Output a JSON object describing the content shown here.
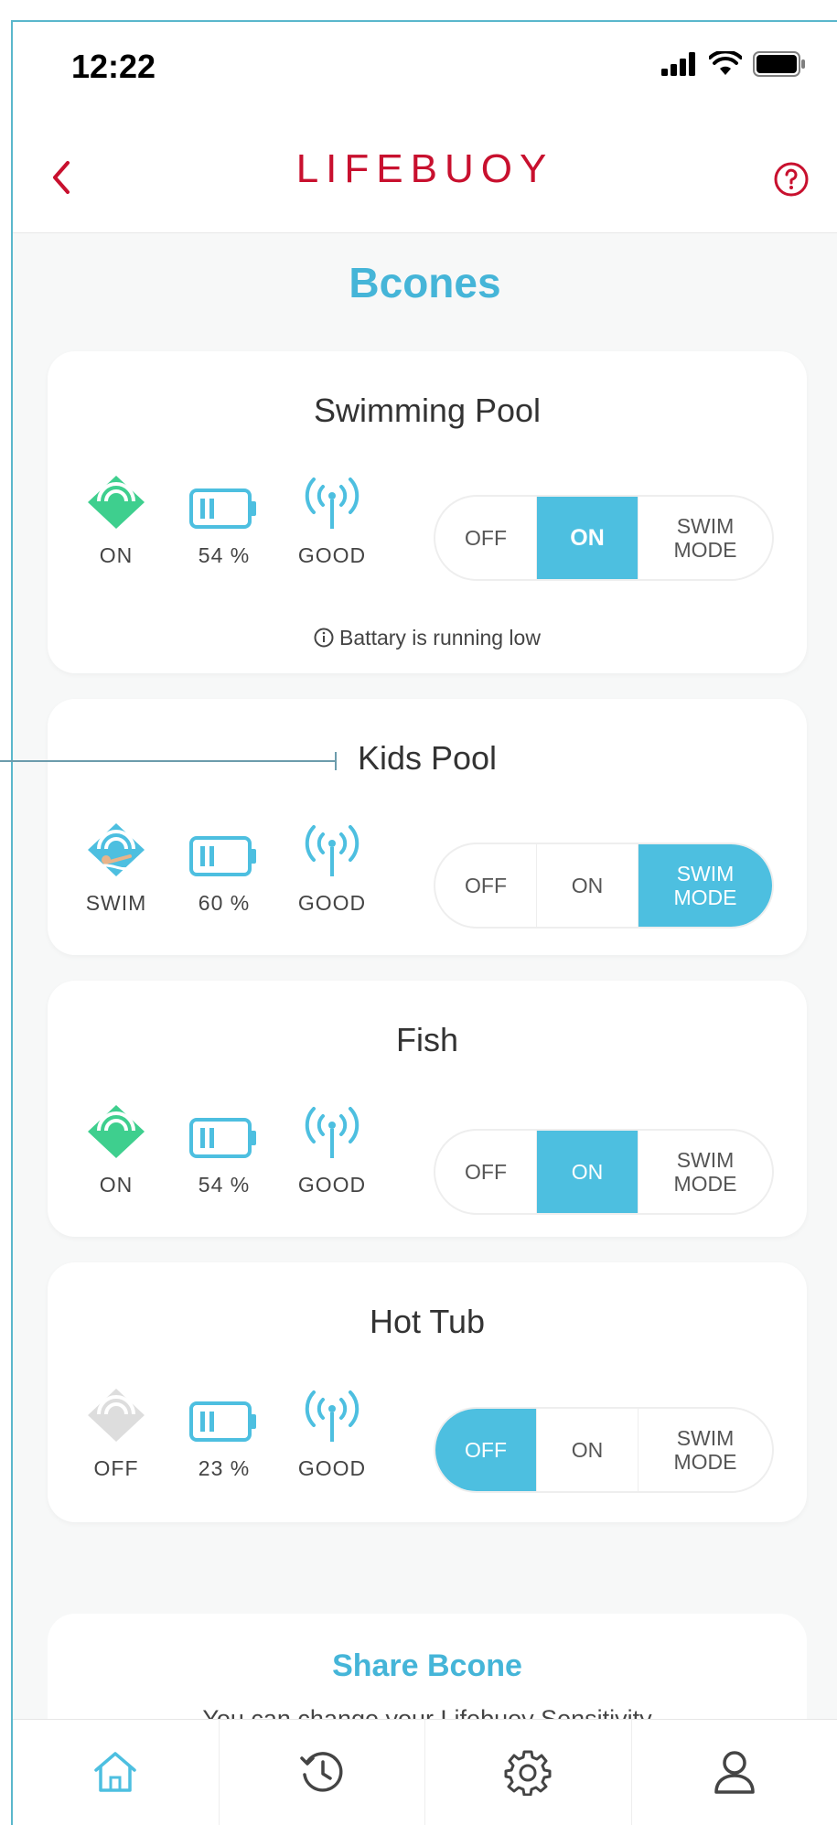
{
  "status_bar": {
    "time": "12:22",
    "icons": [
      "signal-icon",
      "wifi-icon",
      "battery-icon"
    ]
  },
  "header": {
    "logo": "LIFEBUOY",
    "back_icon": "chevron-left-icon",
    "help_icon": "help-circle-icon"
  },
  "page": {
    "title": "Bcones"
  },
  "colors": {
    "accent": "#4dbfe0",
    "brand": "#c8102e",
    "on_green": "#3ecf8e",
    "off_grey": "#dddddd"
  },
  "bcones": [
    {
      "name": "Swimming Pool",
      "status": "ON",
      "battery": "54 %",
      "signal": "GOOD",
      "mode_options": [
        "OFF",
        "ON",
        "SWIM MODE"
      ],
      "selected_mode": "ON",
      "note": "Battary is running low"
    },
    {
      "name": "Kids Pool",
      "status": "SWIM",
      "battery": "60 %",
      "signal": "GOOD",
      "mode_options": [
        "OFF",
        "ON",
        "SWIM MODE"
      ],
      "selected_mode": "SWIM MODE"
    },
    {
      "name": "Fish",
      "status": "ON",
      "battery": "54 %",
      "signal": "GOOD",
      "mode_options": [
        "OFF",
        "ON",
        "SWIM MODE"
      ],
      "selected_mode": "ON"
    },
    {
      "name": "Hot Tub",
      "status": "OFF",
      "battery": "23 %",
      "signal": "GOOD",
      "mode_options": [
        "OFF",
        "ON",
        "SWIM MODE"
      ],
      "selected_mode": "OFF"
    }
  ],
  "share": {
    "title": "Share Bcone",
    "text": "You can change your Lifebuoy Sensitivity"
  },
  "tabbar": {
    "items": [
      "home-icon",
      "history-icon",
      "settings-icon",
      "profile-icon"
    ],
    "active": "home-icon"
  }
}
